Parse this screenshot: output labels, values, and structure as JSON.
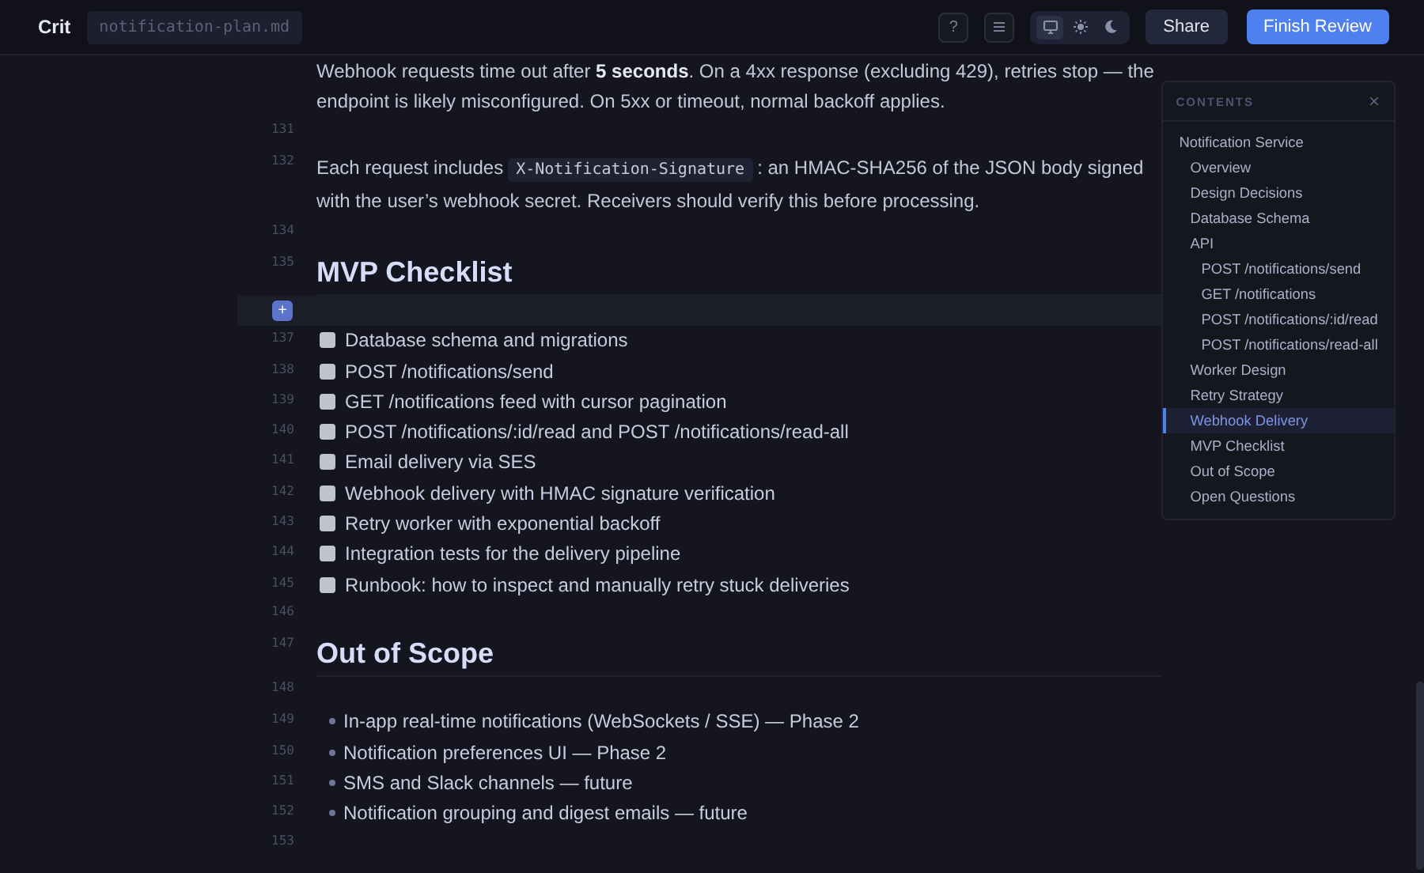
{
  "header": {
    "app_name": "Crit",
    "file_name": "notification-plan.md",
    "help_icon": "?",
    "share_button": "Share",
    "finish_button": "Finish Review",
    "theme_options": [
      {
        "kind": "monitor",
        "selected": true
      },
      {
        "kind": "sun",
        "selected": false
      },
      {
        "kind": "moon",
        "selected": false
      }
    ]
  },
  "document": {
    "lines": [
      {
        "kind": "para",
        "text": "Webhook requests time out after **5 seconds**. On a 4xx response (excluding 429), retries stop — the endpoint is likely misconfigured. On 5xx or timeout, normal backoff applies."
      },
      {
        "kind": "blank",
        "number": "131"
      },
      {
        "kind": "code_para",
        "number": "132",
        "text_before": "Each request includes",
        "code": "X-Notification-Signature",
        "text_after": ": an HMAC-SHA256 of the JSON body signed with the user’s webhook secret. Receivers should verify this before processing."
      },
      {
        "kind": "blank",
        "number": "134"
      },
      {
        "kind": "heading",
        "number": "135",
        "text": "MVP Checklist"
      },
      {
        "kind": "hover",
        "button": "+"
      },
      {
        "kind": "task",
        "number": "137",
        "text": "Database schema and migrations",
        "checked": false
      },
      {
        "kind": "task",
        "number": "138",
        "text": "POST /notifications/send",
        "checked": false
      },
      {
        "kind": "task",
        "number": "139",
        "text": "GET /notifications feed with cursor pagination",
        "checked": false
      },
      {
        "kind": "task",
        "number": "140",
        "text": "POST /notifications/:id/read and POST /notifications/read-all",
        "checked": false
      },
      {
        "kind": "task",
        "number": "141",
        "text": "Email delivery via SES",
        "checked": false
      },
      {
        "kind": "task",
        "number": "142",
        "text": "Webhook delivery with HMAC signature verification",
        "checked": false
      },
      {
        "kind": "task",
        "number": "143",
        "text": "Retry worker with exponential backoff",
        "checked": false
      },
      {
        "kind": "task",
        "number": "144",
        "text": "Integration tests for the delivery pipeline",
        "checked": false
      },
      {
        "kind": "task",
        "number": "145",
        "text": "Runbook: how to inspect and manually retry stuck deliveries",
        "checked": false
      },
      {
        "kind": "blank",
        "number": "146"
      },
      {
        "kind": "heading",
        "number": "147",
        "text": "Out of Scope"
      },
      {
        "kind": "blank",
        "number": "148"
      },
      {
        "kind": "bullet",
        "number": "149",
        "text": "In-app real-time notifications (WebSockets / SSE) — Phase 2"
      },
      {
        "kind": "bullet",
        "number": "150",
        "text": "Notification preferences UI — Phase 2"
      },
      {
        "kind": "bullet",
        "number": "151",
        "text": "SMS and Slack channels — future"
      },
      {
        "kind": "bullet",
        "number": "152",
        "text": "Notification grouping and digest emails — future"
      },
      {
        "kind": "blank",
        "number": "153"
      }
    ]
  },
  "contents": {
    "title": "CONTENTS",
    "close": "×",
    "items": [
      {
        "label": "Notification Service",
        "selected": false,
        "children": [
          {
            "label": "Overview",
            "selected": false
          },
          {
            "label": "Design Decisions",
            "selected": false
          },
          {
            "label": "Database Schema",
            "selected": false
          },
          {
            "label": "API",
            "selected": false,
            "children": [
              {
                "label": "POST /notifications/send",
                "selected": false
              },
              {
                "label": "GET /notifications",
                "selected": false
              },
              {
                "label": "POST /notifications/:id/read",
                "selected": false
              },
              {
                "label": "POST /notifications/read-all",
                "selected": false
              }
            ]
          },
          {
            "label": "Worker Design",
            "selected": false
          },
          {
            "label": "Retry Strategy",
            "selected": false
          },
          {
            "label": "Webhook Delivery",
            "selected": true
          },
          {
            "label": "MVP Checklist",
            "selected": false
          },
          {
            "label": "Out of Scope",
            "selected": false
          },
          {
            "label": "Open Questions",
            "selected": false
          }
        ]
      }
    ]
  }
}
